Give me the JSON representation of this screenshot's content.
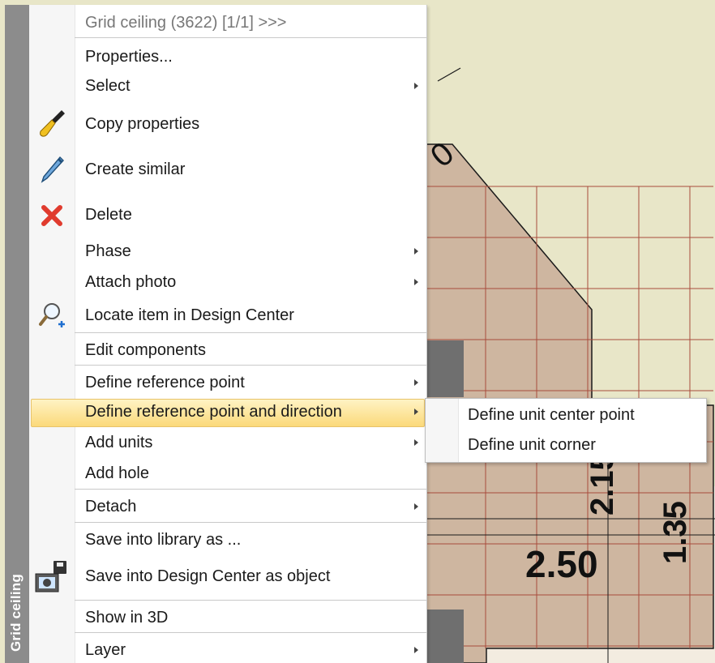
{
  "side_panel": {
    "title": "Grid ceiling"
  },
  "menu": {
    "header": "Grid ceiling (3622) [1/1] >>>",
    "items": [
      {
        "label": "Properties...",
        "icon": null,
        "submenu": false
      },
      {
        "label": "Select",
        "icon": null,
        "submenu": true
      },
      {
        "label": "Copy properties",
        "icon": "paintbrush-icon",
        "submenu": false
      },
      {
        "label": "Create similar",
        "icon": "eyedropper-icon",
        "submenu": false
      },
      {
        "label": "Delete",
        "icon": "delete-x-icon",
        "submenu": false
      },
      {
        "label": "Phase",
        "icon": null,
        "submenu": true
      },
      {
        "label": "Attach photo",
        "icon": null,
        "submenu": true
      },
      {
        "label": "Locate item in Design Center",
        "icon": "magnifier-plus-icon",
        "submenu": false
      },
      {
        "label": "Edit components",
        "icon": null,
        "submenu": false
      },
      {
        "label": "Define reference point",
        "icon": null,
        "submenu": true
      },
      {
        "label": "Define reference point and direction",
        "icon": null,
        "submenu": true,
        "highlighted": true
      },
      {
        "label": "Add units",
        "icon": null,
        "submenu": true
      },
      {
        "label": "Add hole",
        "icon": null,
        "submenu": false
      },
      {
        "label": "Detach",
        "icon": null,
        "submenu": true
      },
      {
        "label": "Save into library as ...",
        "icon": null,
        "submenu": false
      },
      {
        "label": "Save into Design Center as object",
        "icon": "save-photo-icon",
        "submenu": false
      },
      {
        "label": "Show in 3D",
        "icon": null,
        "submenu": false
      },
      {
        "label": "Layer",
        "icon": null,
        "submenu": true
      }
    ]
  },
  "submenu": {
    "items": [
      {
        "label": "Define unit center point"
      },
      {
        "label": "Define unit corner"
      }
    ]
  },
  "drawing": {
    "dimension_texts": [
      "2.50",
      "1.35",
      "2.15",
      "0"
    ],
    "colors": {
      "background": "#e8e6c8",
      "tile_fill": "#ceb6a0",
      "grid_lines": "#a84c3c",
      "wall_gray": "#6f6f6f",
      "highlight": "#fbd97a"
    }
  }
}
